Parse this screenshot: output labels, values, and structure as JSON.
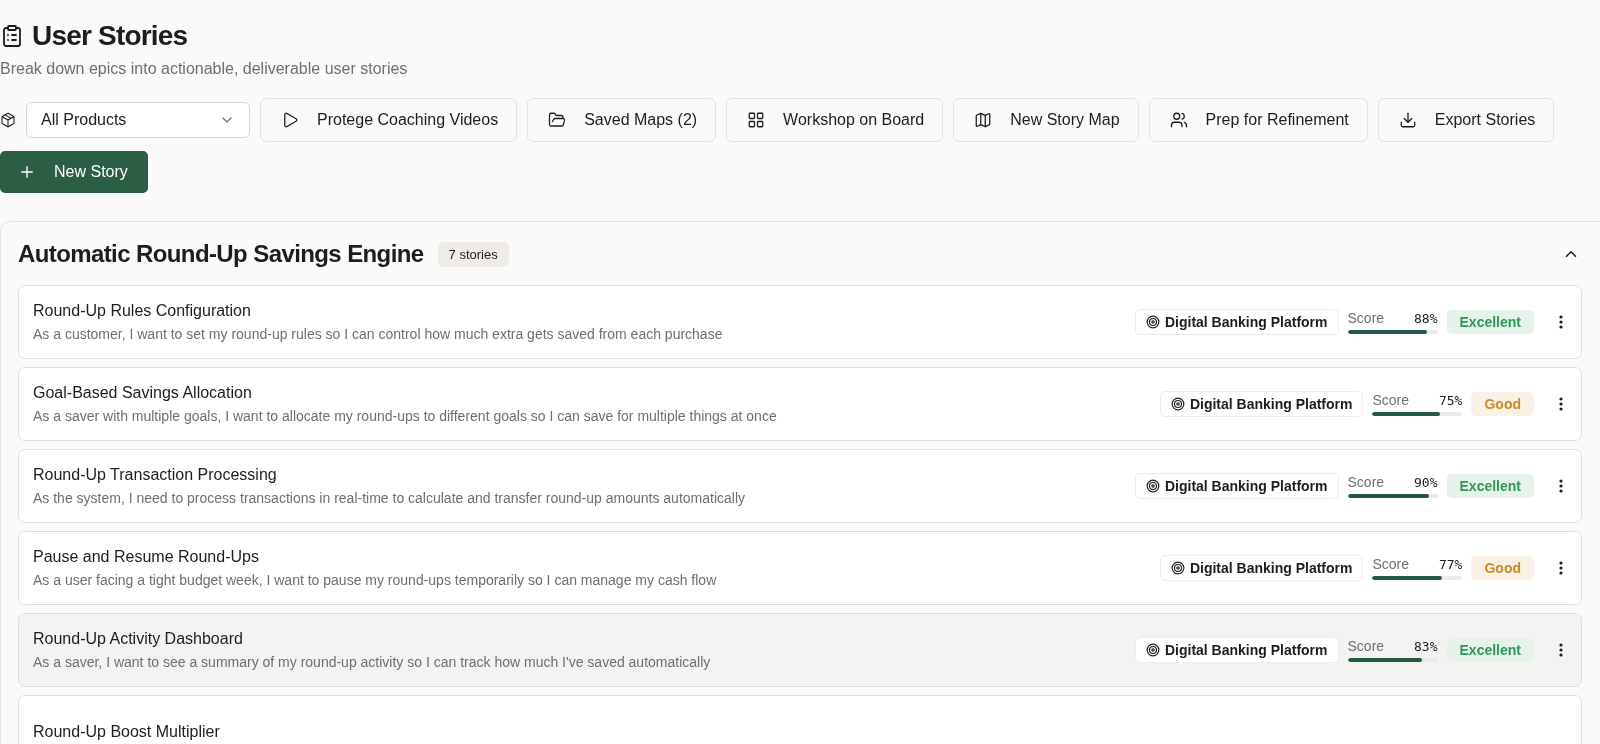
{
  "header": {
    "title": "User Stories",
    "subtitle": "Break down epics into actionable, deliverable user stories"
  },
  "toolbar": {
    "product_select": {
      "value": "All Products"
    },
    "buttons": [
      {
        "kind": "video",
        "label": "Protege Coaching Videos"
      },
      {
        "kind": "folder",
        "label": "Saved Maps (2)"
      },
      {
        "kind": "grid",
        "label": "Workshop on Board"
      },
      {
        "kind": "map",
        "label": "New Story Map"
      },
      {
        "kind": "people",
        "label": "Prep for Refinement"
      },
      {
        "kind": "download",
        "label": "Export Stories"
      }
    ],
    "primary_button": {
      "label": "New Story"
    }
  },
  "epic": {
    "title": "Automatic Round-Up Savings Engine",
    "count": "7 stories",
    "expanded": true,
    "stories": [
      {
        "title": "Round-Up Rules Configuration",
        "description": "As a customer, I want to set my round-up rules so I can control how much extra gets saved from each purchase",
        "product": "Digital Banking Platform",
        "score_label": "Score",
        "score": "88%",
        "level": 0.88,
        "rating": {
          "label": "Excellent",
          "color": "#2e9a56"
        },
        "selected": false
      },
      {
        "title": "Goal-Based Savings Allocation",
        "description": "As a saver with multiple goals, I want to allocate my round-ups to different goals so I can save for multiple things at once",
        "product": "Digital Banking Platform",
        "score_label": "Score",
        "score": "75%",
        "level": 0.75,
        "rating": {
          "label": "Good",
          "color": "#cc8a28"
        },
        "selected": false
      },
      {
        "title": "Round-Up Transaction Processing",
        "description": "As the system, I need to process transactions in real-time to calculate and transfer round-up amounts automatically",
        "product": "Digital Banking Platform",
        "score_label": "Score",
        "score": "90%",
        "level": 0.9,
        "rating": {
          "label": "Excellent",
          "color": "#2e9a56"
        },
        "selected": false
      },
      {
        "title": "Pause and Resume Round-Ups",
        "description": "As a user facing a tight budget week, I want to pause my round-ups temporarily so I can manage my cash flow",
        "product": "Digital Banking Platform",
        "score_label": "Score",
        "score": "77%",
        "level": 0.77,
        "rating": {
          "label": "Good",
          "color": "#cc8a28"
        },
        "selected": false
      },
      {
        "title": "Round-Up Activity Dashboard",
        "description": "As a saver, I want to see a summary of my round-up activity so I can track how much I've saved automatically",
        "product": "Digital Banking Platform",
        "score_label": "Score",
        "score": "83%",
        "level": 0.83,
        "rating": {
          "label": "Excellent",
          "color": "#2e9a56"
        },
        "selected": true
      },
      {
        "title": "Round-Up Boost Multiplier",
        "selected": false
      }
    ]
  }
}
